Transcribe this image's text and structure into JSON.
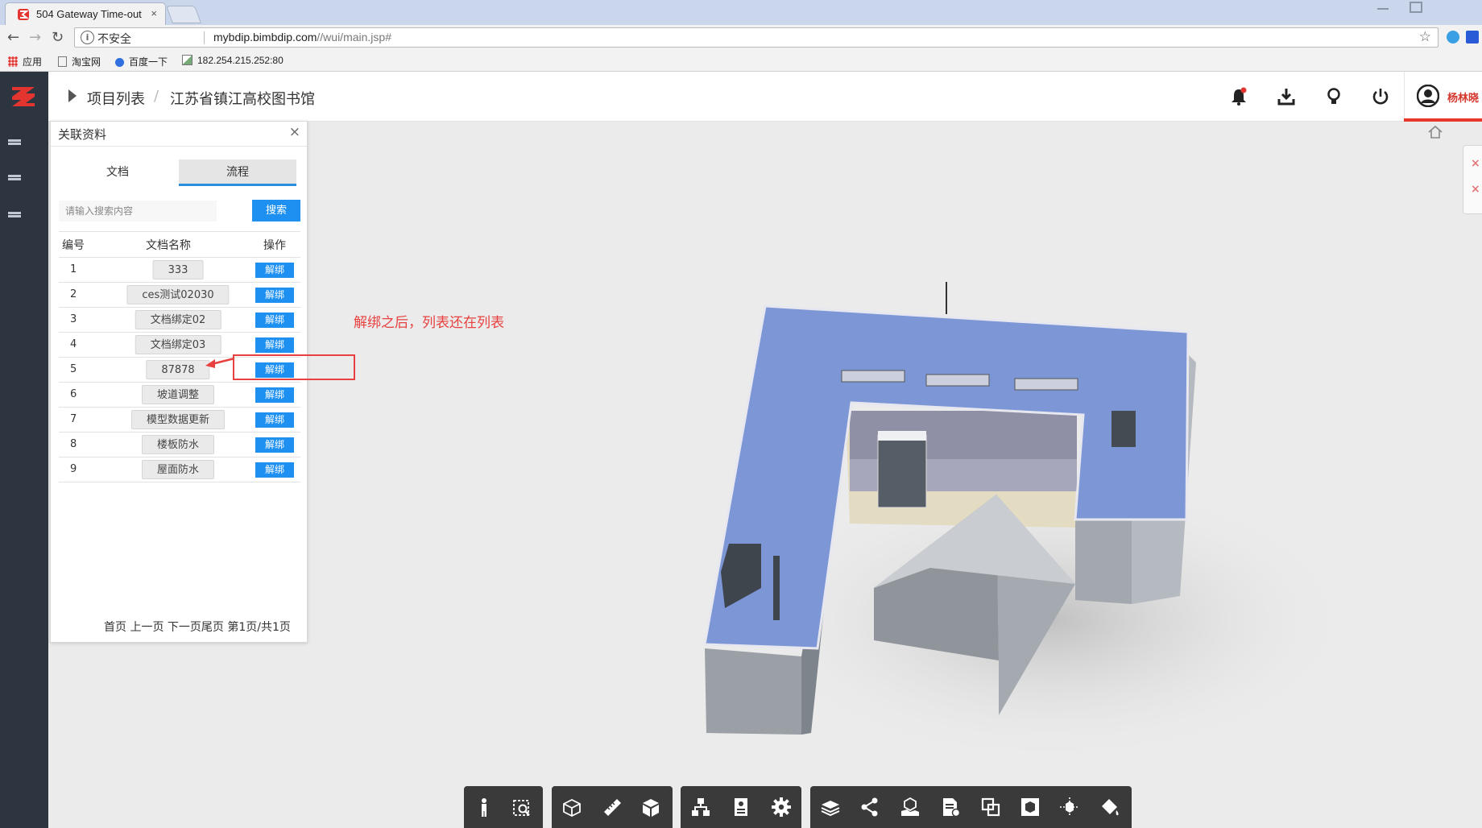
{
  "browser": {
    "tab_title": "504 Gateway Time-out",
    "tab_close": "×",
    "security_label": "不安全",
    "url_host": "mybdip.bimbdip.com",
    "url_path": "//wui/main.jsp#",
    "bookmarks": [
      "应用",
      "淘宝网",
      "百度一下",
      "182.254.215.252:80"
    ]
  },
  "header": {
    "crumbs": [
      "项目列表",
      "江苏省镇江高校图书馆"
    ],
    "crumb_separator": "/",
    "user_name": "杨林晓"
  },
  "panel": {
    "title": "关联资料",
    "close": "×",
    "tabs": [
      "文档",
      "流程"
    ],
    "active_tab": "流程",
    "search_placeholder": "请输入搜索内容",
    "search_button": "搜索",
    "columns": [
      "编号",
      "文档名称",
      "操作"
    ],
    "rows": [
      {
        "no": "1",
        "name": "333",
        "action": "解绑"
      },
      {
        "no": "2",
        "name": "ces测试02030",
        "action": "解绑"
      },
      {
        "no": "3",
        "name": "文档绑定02",
        "action": "解绑"
      },
      {
        "no": "4",
        "name": "文档绑定03",
        "action": "解绑"
      },
      {
        "no": "5",
        "name": "87878",
        "action": "解绑"
      },
      {
        "no": "6",
        "name": "坡道调整",
        "action": "解绑"
      },
      {
        "no": "7",
        "name": "模型数据更新",
        "action": "解绑"
      },
      {
        "no": "8",
        "name": "楼板防水",
        "action": "解绑"
      },
      {
        "no": "9",
        "name": "屋面防水",
        "action": "解绑"
      }
    ],
    "pager": "首页 上一页 下一页尾页 第1页/共1页"
  },
  "annotation": {
    "text": "解绑之后，列表还在列表",
    "color": "#e8413f"
  },
  "toolbar": {
    "groups": [
      [
        "person-icon",
        "zoom-area-icon"
      ],
      [
        "section-box-icon",
        "measure-icon",
        "cube-view-icon"
      ],
      [
        "tree-icon",
        "properties-icon",
        "settings-icon"
      ],
      [
        "layers-icon",
        "share-icon",
        "hand-icon",
        "document-icon",
        "copy-icon",
        "box-icon",
        "explode-icon",
        "paint-icon"
      ]
    ]
  },
  "colors": {
    "accent": "#1e90f2",
    "sidebar": "#2d3540",
    "toolbar": "#3a3a3a",
    "roof": "#7d96d6",
    "alert": "#e8372c"
  }
}
